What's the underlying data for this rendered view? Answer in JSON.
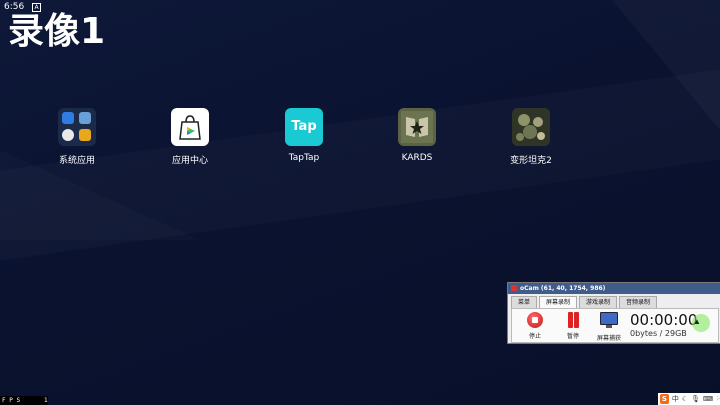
{
  "status_bar": {
    "time": "6:56",
    "indicator": "A"
  },
  "title": "录像1",
  "apps": [
    {
      "label": "系统应用",
      "icon": "system-apps-folder-icon"
    },
    {
      "label": "应用中心",
      "icon": "app-center-bag-icon"
    },
    {
      "label": "TapTap",
      "icon": "taptap-icon",
      "icon_text": "Tap"
    },
    {
      "label": "KARDS",
      "icon": "kards-icon"
    },
    {
      "label": "变形坦克2",
      "icon": "tank-game-icon"
    }
  ],
  "ocam": {
    "title": "oCam (61, 40, 1754, 986)",
    "tabs": [
      "菜单",
      "屏幕录制",
      "游戏录制",
      "音频录制"
    ],
    "active_tab": "屏幕录制",
    "buttons": {
      "stop": "停止",
      "pause": "暂停",
      "capture": "屏幕捕获"
    },
    "timer": "00:00:00",
    "size": "0bytes / 29GB"
  },
  "fps": {
    "label": "F P S",
    "value": "1"
  },
  "tray": {
    "ime_logo": "S",
    "ime_mode": "中"
  },
  "colors": {
    "accent": "#19c9d3",
    "background": "#0a1230",
    "record": "#d22222"
  }
}
